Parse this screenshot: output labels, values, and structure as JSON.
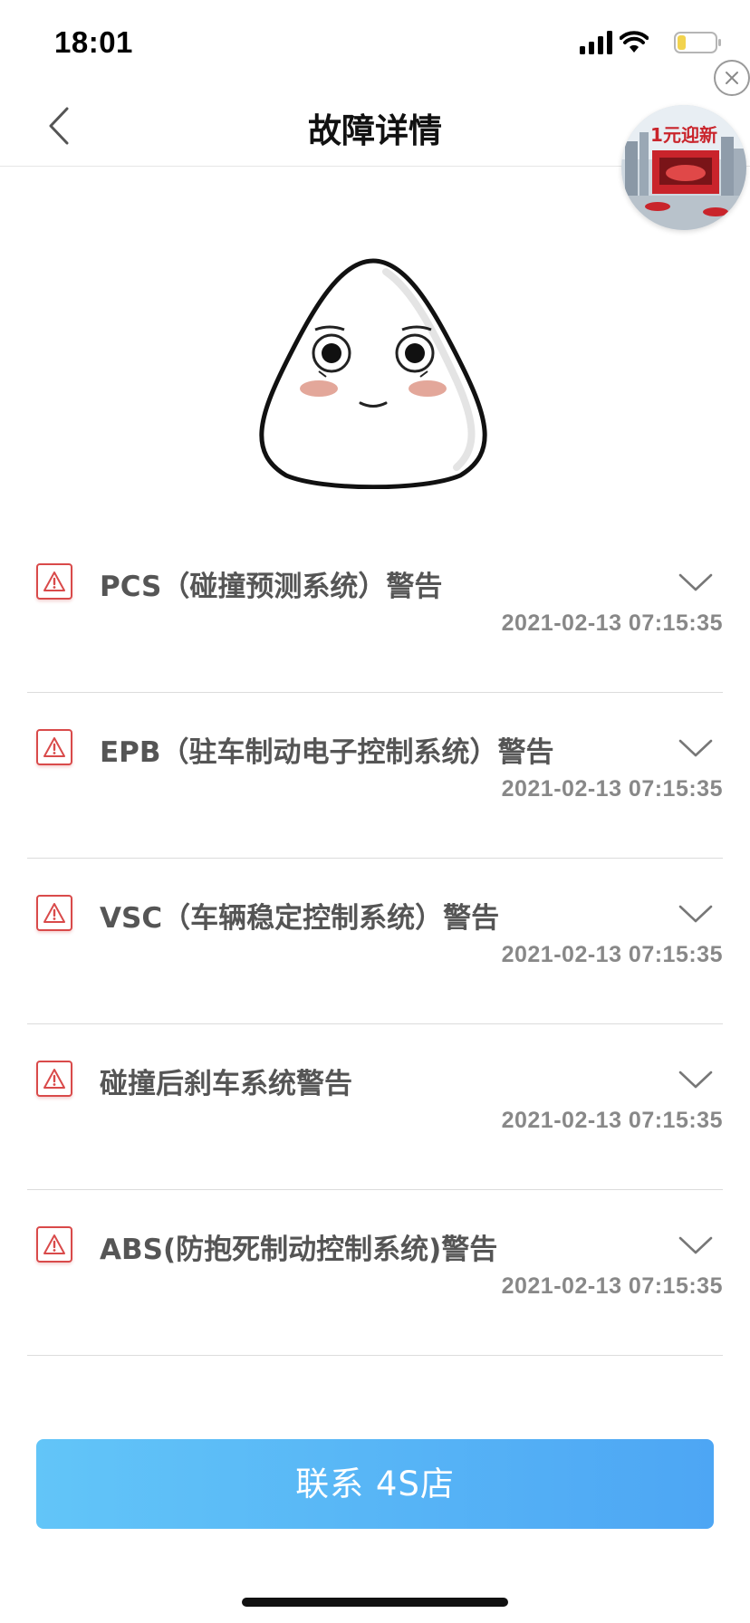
{
  "status_bar": {
    "time": "18:01"
  },
  "nav": {
    "title": "故障详情"
  },
  "faults": [
    {
      "title": "PCS（碰撞预测系统）警告",
      "time": "2021-02-13 07:15:35"
    },
    {
      "title": "EPB（驻车制动电子控制系统）警告",
      "time": "2021-02-13 07:15:35"
    },
    {
      "title": "VSC（车辆稳定控制系统）警告",
      "time": "2021-02-13 07:15:35"
    },
    {
      "title": "碰撞后刹车系统警告",
      "time": "2021-02-13 07:15:35"
    },
    {
      "title": "ABS(防抱死制动控制系统)警告",
      "time": "2021-02-13 07:15:35"
    }
  ],
  "contact_button": {
    "label": "联系 4S店"
  },
  "floating_ad": {
    "text": "1元迎新"
  },
  "colors": {
    "warning": "#d94a4a",
    "button_start": "#62c5f8",
    "button_end": "#4da6f4"
  }
}
